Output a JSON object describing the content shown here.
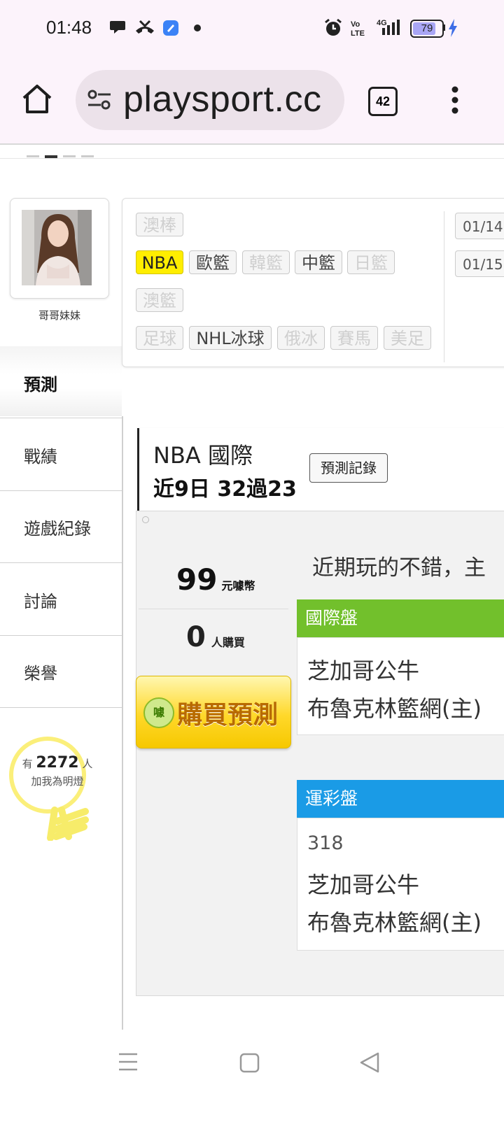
{
  "status_bar": {
    "time": "01:48",
    "battery": "79",
    "network": "4G"
  },
  "browser": {
    "url": "playsport.cc",
    "tab_count": "42"
  },
  "sidebar": {
    "user_name": "哥哥妹妹",
    "items": [
      {
        "label": "預測"
      },
      {
        "label": "戰績"
      },
      {
        "label": "遊戲紀錄"
      },
      {
        "label": "討論"
      },
      {
        "label": "榮譽"
      }
    ],
    "fans": {
      "prefix": "有",
      "count": "2272",
      "suffix": "人",
      "caption": "加我為明燈"
    }
  },
  "sports": {
    "row1": [
      "澳棒"
    ],
    "row2": [
      "NBA",
      "歐籃",
      "韓籃",
      "中籃",
      "日籃"
    ],
    "row3": [
      "澳籃"
    ],
    "row4": [
      "足球",
      "NHL冰球",
      "俄冰",
      "賽馬",
      "美足"
    ],
    "dates": [
      "01/14",
      "01/15"
    ]
  },
  "prediction": {
    "league": "NBA 國際",
    "record": "近9日 32過23",
    "history_button": "預測記錄",
    "price": "99",
    "price_unit": "元噱幣",
    "buyers": "0",
    "buyers_unit": "人購買",
    "buy_button": "購買預測",
    "coin_label": "噱",
    "comment": "近期玩的不錯，主",
    "intl_header": "國際盤",
    "intl_team1": "芝加哥公牛",
    "intl_team2": "布魯克林籃網(主)",
    "lottery_header": "運彩盤",
    "lottery_number": "318",
    "lottery_team1": "芝加哥公牛",
    "lottery_team2": "布魯克林籃網(主)"
  },
  "colors": {
    "active_chip": "#ffee00",
    "intl_header": "#72c02c",
    "lottery_header": "#1a9be6"
  }
}
